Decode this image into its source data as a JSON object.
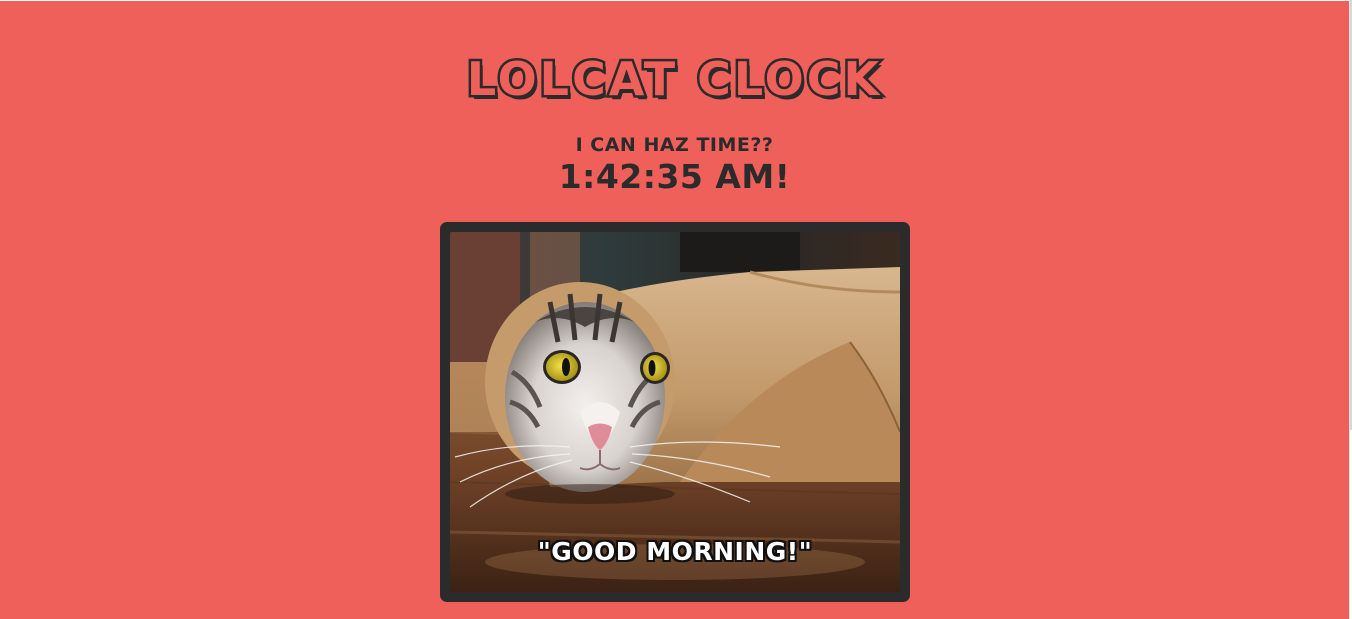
{
  "app": {
    "title": "LOLCAT CLOCK"
  },
  "clock": {
    "question": "I CAN HAZ TIME??",
    "time": "1:42:35 AM!"
  },
  "photo": {
    "caption": "\"GOOD MORNING!\"",
    "subject": "cat-wrapped-in-paper-image"
  },
  "colors": {
    "background": "#f0605a",
    "text_dark": "#2b2b2b",
    "frame": "#2b2b2b"
  }
}
